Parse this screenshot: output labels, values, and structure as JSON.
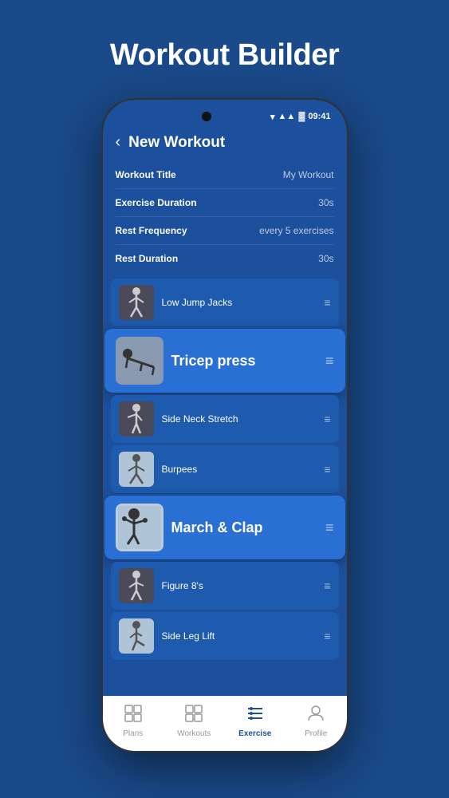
{
  "page": {
    "title": "Workout Builder",
    "bg_color": "#1a4a8a"
  },
  "status_bar": {
    "time": "09:41"
  },
  "header": {
    "back_label": "‹",
    "title": "New Workout"
  },
  "settings": [
    {
      "label": "Workout Title",
      "value": "My Workout"
    },
    {
      "label": "Exercise Duration",
      "value": "30s"
    },
    {
      "label": "Rest Frequency",
      "value": "every 5 exercises"
    },
    {
      "label": "Rest Duration",
      "value": "30s"
    }
  ],
  "exercises": [
    {
      "name": "Low Jump Jacks",
      "highlighted": false,
      "emoji": "🏃"
    },
    {
      "name": "Tricep press",
      "highlighted": true,
      "emoji": "💪"
    },
    {
      "name": "Side Neck Stretch",
      "highlighted": false,
      "emoji": "🧘"
    },
    {
      "name": "Burpees",
      "highlighted": false,
      "emoji": "🤸"
    },
    {
      "name": "March & Clap",
      "highlighted": true,
      "emoji": "👏"
    },
    {
      "name": "Figure 8's",
      "highlighted": false,
      "emoji": "🔄"
    },
    {
      "name": "Side Leg Lift",
      "highlighted": false,
      "emoji": "🦵"
    }
  ],
  "bottom_nav": [
    {
      "label": "Plans",
      "active": false,
      "icon": "⊞"
    },
    {
      "label": "Workouts",
      "active": false,
      "icon": "⊞"
    },
    {
      "label": "Exercise",
      "active": true,
      "icon": "☰"
    },
    {
      "label": "Profile",
      "active": false,
      "icon": "👤"
    }
  ],
  "drag_icon": "≡"
}
